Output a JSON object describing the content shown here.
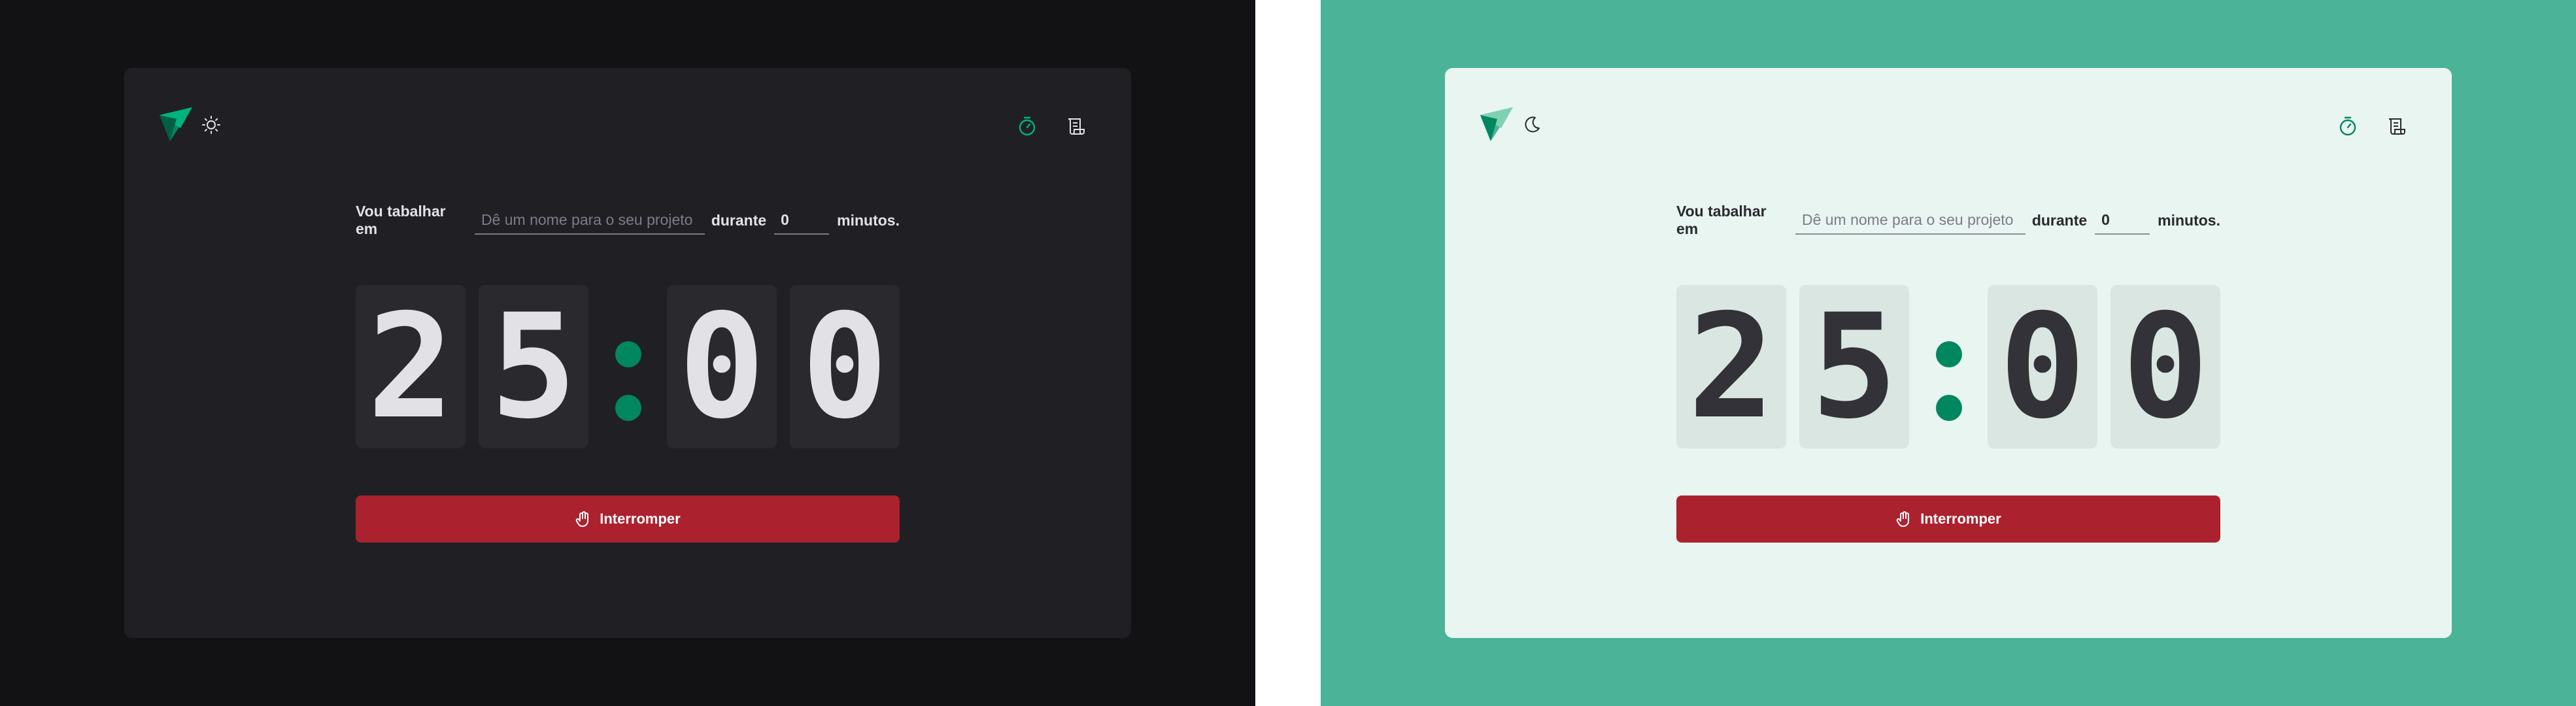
{
  "panels": {
    "dark": {
      "theme_toggle_icon": "sun-icon",
      "form": {
        "prefix": "Vou tabalhar em",
        "task_placeholder": "Dê um nome para o seu projeto",
        "middle": "durante",
        "minutes_value": "0",
        "suffix": "minutos."
      },
      "countdown": {
        "digits": [
          "2",
          "5",
          "0",
          "0"
        ],
        "separator": ":"
      },
      "stop_button": {
        "label": "Interromper",
        "icon": "hand-palm-icon"
      }
    },
    "light": {
      "theme_toggle_icon": "moon-icon",
      "form": {
        "prefix": "Vou tabalhar em",
        "task_placeholder": "Dê um nome para o seu projeto",
        "middle": "durante",
        "minutes_value": "0",
        "suffix": "minutos."
      },
      "countdown": {
        "digits": [
          "2",
          "5",
          "0",
          "0"
        ],
        "separator": ":"
      },
      "stop_button": {
        "label": "Interromper",
        "icon": "hand-palm-icon"
      }
    }
  },
  "nav": {
    "timer_icon": "timer-icon",
    "history_icon": "scroll-icon"
  },
  "colors": {
    "dark_background": "#121214",
    "dark_card": "#202024",
    "light_background": "#4bb398",
    "light_card": "#e8f5f0",
    "accent_green": "#00875f",
    "stop_red": "#ab222e"
  }
}
